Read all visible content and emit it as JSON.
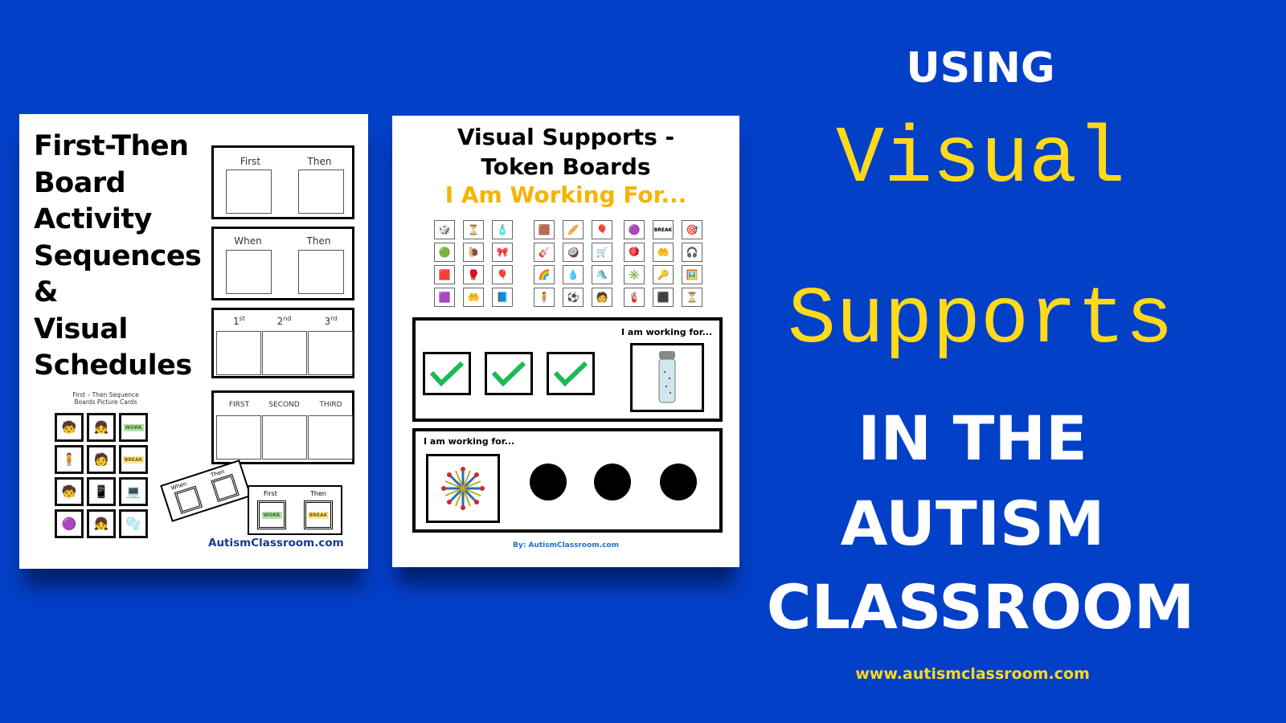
{
  "colors": {
    "background": "#0340c8",
    "accent_yellow": "#ffd91a",
    "title_white": "#ffffff",
    "orange_subtitle": "#f5b400",
    "check_green": "#1db954"
  },
  "page1": {
    "title_lines": [
      "First-Then",
      "Board",
      "Activity",
      "Sequences",
      "&",
      "Visual",
      "Schedules"
    ],
    "boards": [
      {
        "labels": [
          "First",
          "Then"
        ]
      },
      {
        "labels": [
          "When",
          "Then"
        ]
      },
      {
        "labels": [
          "1st",
          "2nd",
          "3rd"
        ]
      },
      {
        "labels": [
          "FIRST",
          "SECOND",
          "THIRD"
        ]
      }
    ],
    "cards_title": "First – Then Sequence Boards Picture Cards",
    "cards": [
      {
        "icon": "child-at-desk",
        "glyph": "🧒"
      },
      {
        "icon": "child-working",
        "glyph": "👧"
      },
      {
        "tag": "WORK"
      },
      {
        "icon": "child-on-mat",
        "glyph": "🧍"
      },
      {
        "icon": "child-resting",
        "glyph": "🧑"
      },
      {
        "tag": "BREAK"
      },
      {
        "icon": "child-playing",
        "glyph": "🧒"
      },
      {
        "icon": "tablet",
        "glyph": "📱"
      },
      {
        "icon": "computer",
        "glyph": "💻"
      },
      {
        "icon": "fidget-toy",
        "glyph": "🟣"
      },
      {
        "icon": "snack",
        "glyph": "👧"
      },
      {
        "icon": "bubbles",
        "glyph": "🫧"
      }
    ],
    "mini_board_rotated": {
      "labels": [
        "When",
        "Then"
      ]
    },
    "mini_board": {
      "labels": [
        "First",
        "Then"
      ],
      "tags": [
        "WORK",
        "BREAK"
      ]
    },
    "footer": "AutismClassroom.com"
  },
  "page2": {
    "title_line1": "Visual Supports -",
    "title_line2": "Token Boards",
    "subtitle": "I Am Working For...",
    "icon_grids": [
      [
        "🎲",
        "⏳",
        "🧴",
        "🟢",
        "🐌",
        "🎀",
        "🟥",
        "🥊",
        "🎈",
        "🟪",
        "🤲",
        "📘"
      ],
      [
        "🟫",
        "🥖",
        "🎈",
        "🎸",
        "🥥",
        "🛒",
        "🌈",
        "💧",
        "🛝",
        "🧍",
        "⚽",
        "🧑"
      ],
      [
        "🟣",
        "BREAK",
        "🎯",
        "🪀",
        "🤲",
        "🎧",
        "✳️",
        "🔑",
        "🖼️",
        "🧯",
        "⬛",
        "⏳"
      ]
    ],
    "board1": {
      "label": "I am working for...",
      "checks": 3,
      "reward": "sensory-bottle",
      "reward_glyph": "🧴"
    },
    "board2": {
      "label": "I am working for...",
      "reward": "hoberman-sphere",
      "reward_glyph": "✴️",
      "tokens_remaining": 3
    },
    "footer": "By: AutismClassroom.com"
  },
  "headline": {
    "line1": "USING",
    "line2": "Visual",
    "line3": "Supports",
    "line4": "IN THE",
    "line5": "AUTISM",
    "line6": "CLASSROOM",
    "url": "www.autismclassroom.com"
  }
}
